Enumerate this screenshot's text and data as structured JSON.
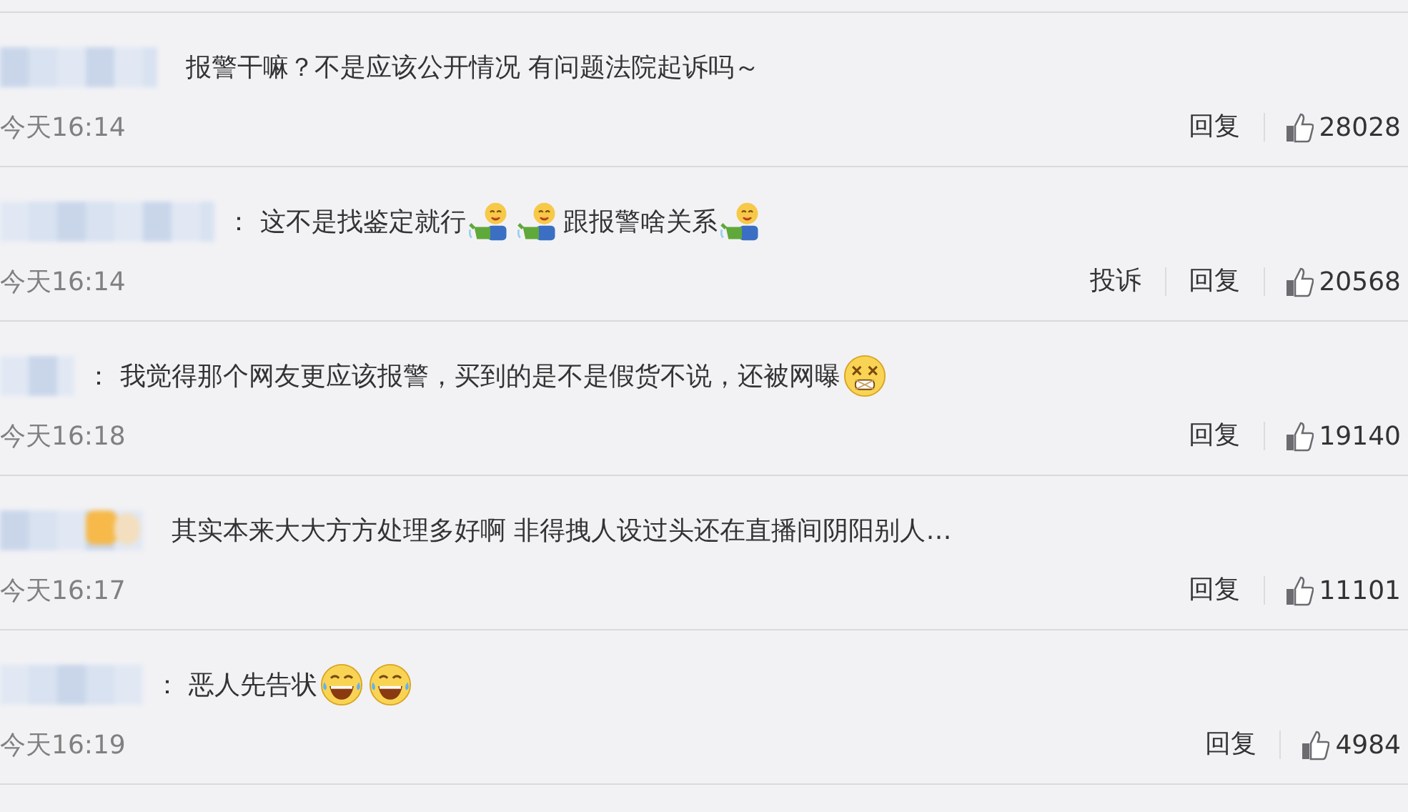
{
  "comments": [
    {
      "content": [
        {
          "kind": "text",
          "text": "报警干嘛？不是应该公开情况 有问题法院起诉吗～"
        }
      ],
      "time": "今天16:14",
      "actions": [
        "回复"
      ],
      "likes": "28028"
    },
    {
      "colon": "：",
      "content": [
        {
          "kind": "text",
          "text": "这不是找鉴定就行"
        },
        {
          "kind": "gardener"
        },
        {
          "kind": "gardener"
        },
        {
          "kind": "text",
          "text": "跟报警啥关系"
        },
        {
          "kind": "gardener"
        }
      ],
      "time": "今天16:14",
      "actions": [
        "投诉",
        "回复"
      ],
      "likes": "20568"
    },
    {
      "colon": "：",
      "content": [
        {
          "kind": "text",
          "text": "我觉得那个网友更应该报警，买到的是不是假货不说，还被网曝"
        },
        {
          "kind": "dizzy"
        }
      ],
      "time": "今天16:18",
      "actions": [
        "回复"
      ],
      "likes": "19140"
    },
    {
      "content": [
        {
          "kind": "text",
          "text": "其实本来大大方方处理多好啊 非得拽人设过头还在直播间阴阳别人…"
        }
      ],
      "time": "今天16:17",
      "actions": [
        "回复"
      ],
      "likes": "11101"
    },
    {
      "colon": "：",
      "content": [
        {
          "kind": "text",
          "text": "恶人先告状"
        },
        {
          "kind": "laughing"
        },
        {
          "kind": "laughing"
        }
      ],
      "time": "今天16:19",
      "actions": [
        "回复"
      ],
      "likes": "4984"
    }
  ]
}
